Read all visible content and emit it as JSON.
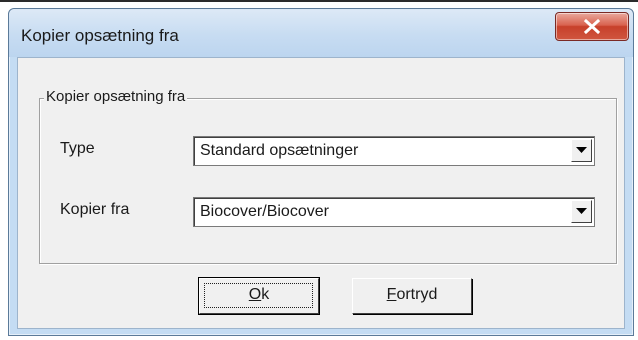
{
  "window": {
    "title": "Kopier opsætning fra",
    "close_icon": "close-x-icon"
  },
  "group": {
    "legend": "Kopier opsætning fra"
  },
  "fields": [
    {
      "label": "Type",
      "value": "Standard opsætninger",
      "arrow_icon": "dropdown-arrow-icon"
    },
    {
      "label": "Kopier fra",
      "value": "Biocover/Biocover",
      "arrow_icon": "dropdown-arrow-icon"
    }
  ],
  "buttons": {
    "ok": {
      "mnemonic": "O",
      "rest": "k"
    },
    "cancel": {
      "mnemonic": "F",
      "rest": "ortryd"
    }
  },
  "colors": {
    "title_bar": "#c4dcf3",
    "close_button": "#c7402b",
    "client_background": "#f0f0f0"
  }
}
